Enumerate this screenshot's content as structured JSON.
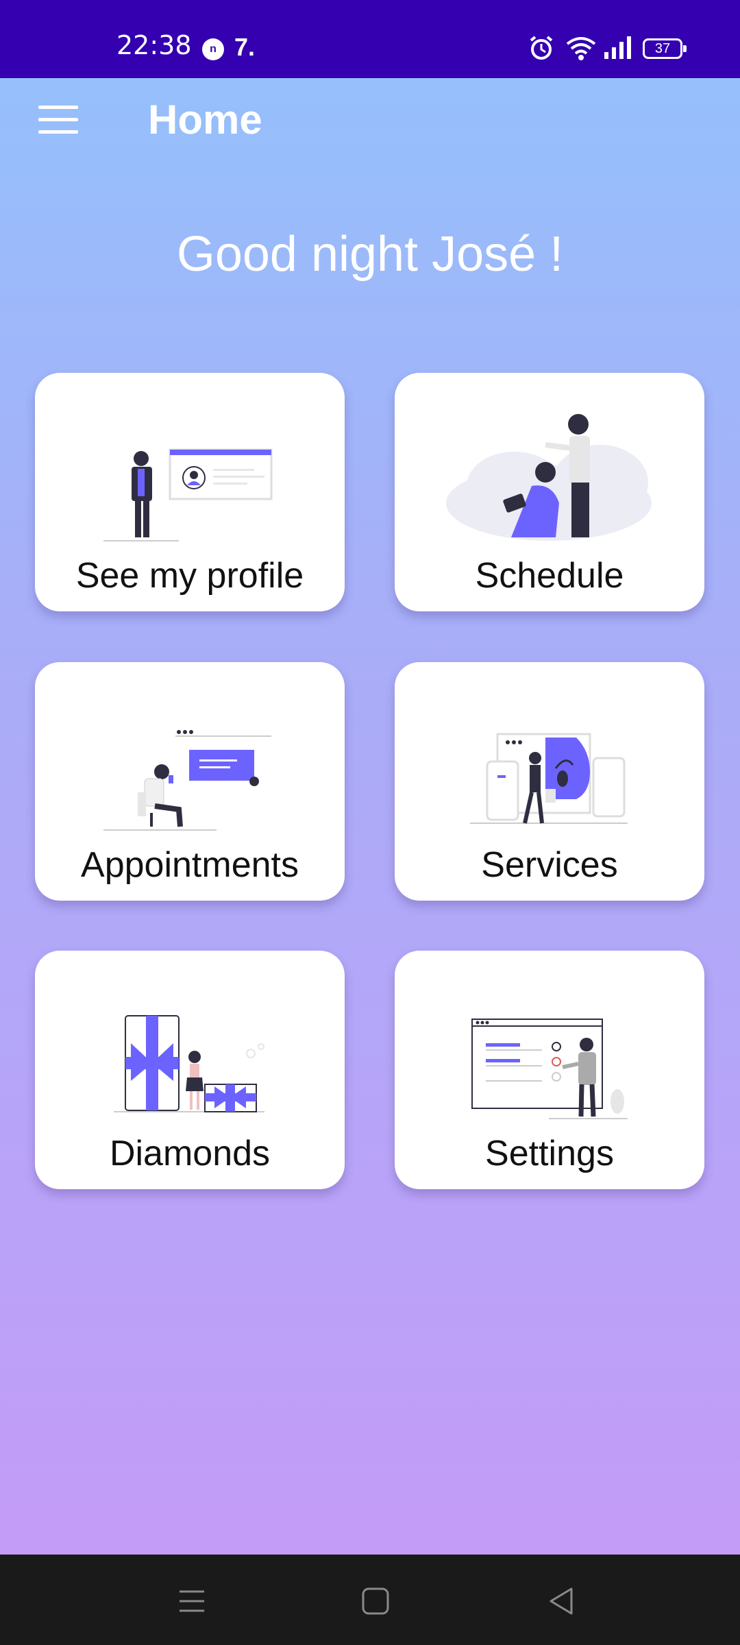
{
  "status_bar": {
    "time": "22:38",
    "notification_badge": "n",
    "app_icon_text": "7.",
    "battery": "37",
    "icons": [
      "alarm-icon",
      "wifi-icon",
      "signal-icon",
      "battery-icon"
    ]
  },
  "app_bar": {
    "title": "Home",
    "menu_icon": "hamburger-menu-icon"
  },
  "greeting": "Good night José !",
  "cards": [
    {
      "label": "See my profile",
      "illustration": "profile-illustration"
    },
    {
      "label": "Schedule",
      "illustration": "barber-schedule-illustration"
    },
    {
      "label": "Appointments",
      "illustration": "appointments-illustration"
    },
    {
      "label": "Services",
      "illustration": "services-illustration"
    },
    {
      "label": "Diamonds",
      "illustration": "gifts-illustration"
    },
    {
      "label": "Settings",
      "illustration": "settings-checklist-illustration"
    }
  ],
  "nav_bar": {
    "icons": [
      "recents-icon",
      "home-icon",
      "back-icon"
    ]
  },
  "colors": {
    "status_bar": "#3400b0",
    "accent": "#6c63ff",
    "gradient_top": "#93c2fc",
    "gradient_bottom": "#c69af7",
    "nav_bar": "#1a1a1a"
  }
}
